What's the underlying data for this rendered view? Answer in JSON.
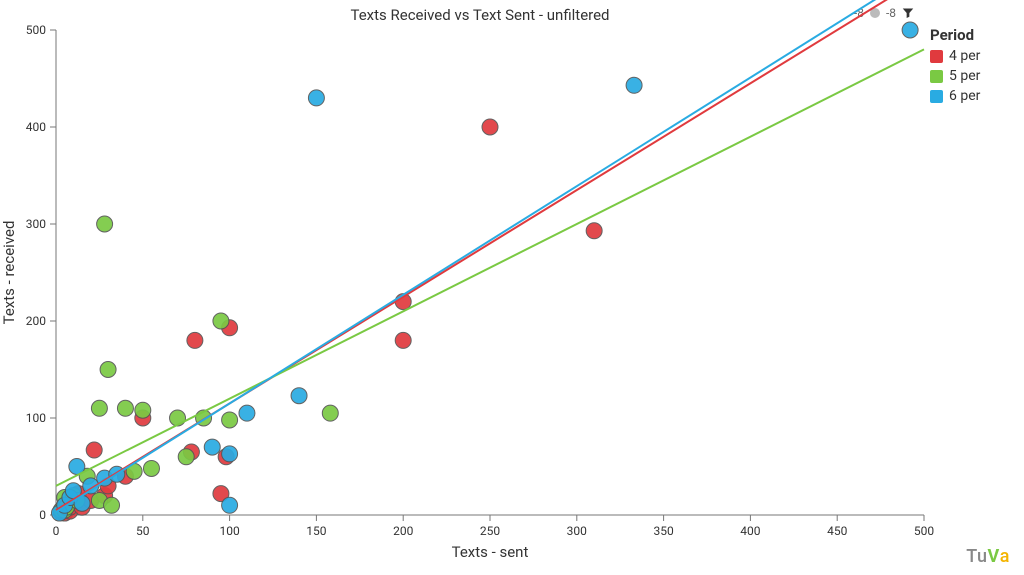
{
  "chart_data": {
    "type": "scatter",
    "title": "Texts Received vs Text Sent - unfiltered",
    "xlabel": "Texts - sent",
    "ylabel": "Texts - received",
    "xlim": [
      0,
      500
    ],
    "ylim": [
      0,
      500
    ],
    "xticks": [
      0,
      50,
      100,
      150,
      200,
      250,
      300,
      350,
      400,
      450,
      500
    ],
    "yticks": [
      0,
      100,
      200,
      300,
      400,
      500
    ],
    "series": [
      {
        "name": "4 per",
        "color": "#e03a3e",
        "trend": {
          "slope": 1.1,
          "intercept": 5
        },
        "points": [
          {
            "x": 3,
            "y": 3
          },
          {
            "x": 5,
            "y": 2
          },
          {
            "x": 8,
            "y": 4
          },
          {
            "x": 8,
            "y": 8
          },
          {
            "x": 10,
            "y": 15
          },
          {
            "x": 13,
            "y": 22
          },
          {
            "x": 15,
            "y": 8
          },
          {
            "x": 20,
            "y": 15
          },
          {
            "x": 22,
            "y": 67
          },
          {
            "x": 28,
            "y": 20
          },
          {
            "x": 30,
            "y": 30
          },
          {
            "x": 40,
            "y": 40
          },
          {
            "x": 50,
            "y": 100
          },
          {
            "x": 78,
            "y": 65
          },
          {
            "x": 80,
            "y": 180
          },
          {
            "x": 95,
            "y": 22
          },
          {
            "x": 98,
            "y": 60
          },
          {
            "x": 100,
            "y": 193
          },
          {
            "x": 200,
            "y": 180
          },
          {
            "x": 200,
            "y": 220
          },
          {
            "x": 250,
            "y": 400
          },
          {
            "x": 310,
            "y": 293
          }
        ]
      },
      {
        "name": "5 per",
        "color": "#7ac943",
        "trend": {
          "slope": 0.9,
          "intercept": 30
        },
        "points": [
          {
            "x": 3,
            "y": 5
          },
          {
            "x": 5,
            "y": 5
          },
          {
            "x": 5,
            "y": 18
          },
          {
            "x": 6,
            "y": 8
          },
          {
            "x": 10,
            "y": 20
          },
          {
            "x": 12,
            "y": 15
          },
          {
            "x": 18,
            "y": 40
          },
          {
            "x": 25,
            "y": 15
          },
          {
            "x": 25,
            "y": 110
          },
          {
            "x": 28,
            "y": 300
          },
          {
            "x": 30,
            "y": 150
          },
          {
            "x": 32,
            "y": 10
          },
          {
            "x": 40,
            "y": 110
          },
          {
            "x": 45,
            "y": 45
          },
          {
            "x": 50,
            "y": 108
          },
          {
            "x": 55,
            "y": 48
          },
          {
            "x": 70,
            "y": 100
          },
          {
            "x": 75,
            "y": 60
          },
          {
            "x": 85,
            "y": 100
          },
          {
            "x": 95,
            "y": 200
          },
          {
            "x": 100,
            "y": 98
          },
          {
            "x": 158,
            "y": 105
          }
        ]
      },
      {
        "name": "6 per",
        "color": "#29abe2",
        "trend": {
          "slope": 1.12,
          "intercept": 3
        },
        "points": [
          {
            "x": 2,
            "y": 2
          },
          {
            "x": 5,
            "y": 10
          },
          {
            "x": 8,
            "y": 18
          },
          {
            "x": 10,
            "y": 25
          },
          {
            "x": 12,
            "y": 50
          },
          {
            "x": 15,
            "y": 12
          },
          {
            "x": 20,
            "y": 30
          },
          {
            "x": 28,
            "y": 38
          },
          {
            "x": 35,
            "y": 42
          },
          {
            "x": 90,
            "y": 70
          },
          {
            "x": 100,
            "y": 10
          },
          {
            "x": 100,
            "y": 63
          },
          {
            "x": 110,
            "y": 105
          },
          {
            "x": 140,
            "y": 123
          },
          {
            "x": 150,
            "y": 430
          },
          {
            "x": 333,
            "y": 443
          },
          {
            "x": 492,
            "y": 500
          }
        ]
      }
    ]
  },
  "legend": {
    "title": "Period"
  },
  "brand": {
    "t": "Tu",
    "v": "V",
    "a": "a"
  },
  "topright": {
    "count_left": "-8",
    "count_right": "-8"
  }
}
